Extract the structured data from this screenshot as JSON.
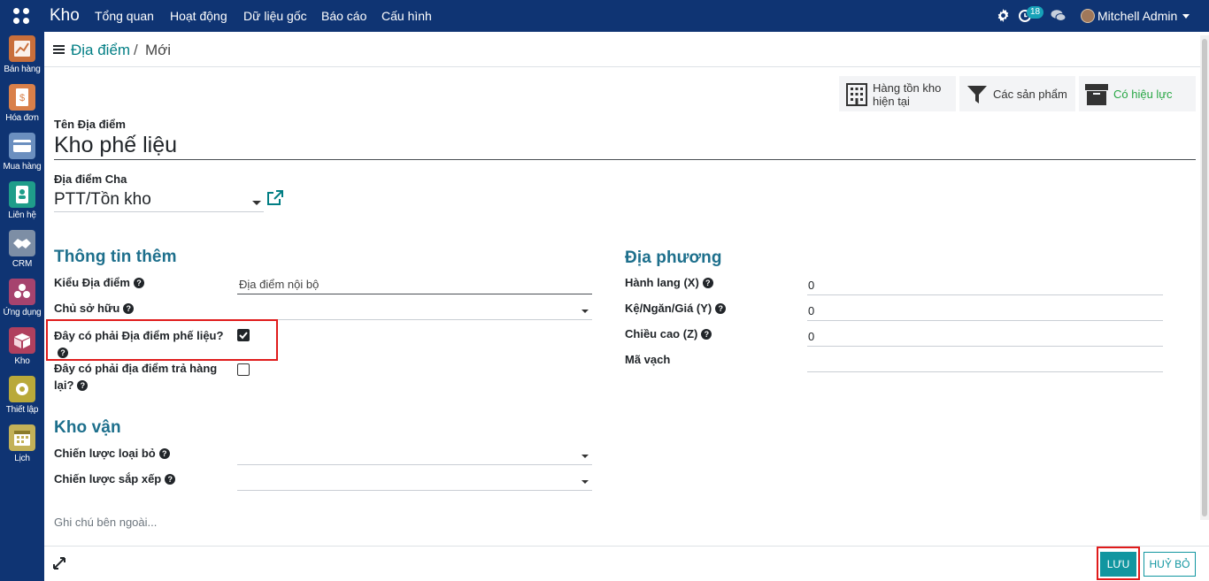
{
  "topbar": {
    "app_name": "Kho",
    "menus": [
      "Tổng quan",
      "Hoạt động",
      "Dữ liệu gốc",
      "Báo cáo",
      "Cấu hình"
    ],
    "activity_count": "18",
    "user_name": "Mitchell Admin",
    "icons": [
      "apps-grid-icon",
      "gear-icon",
      "clock-icon",
      "chat-icon",
      "user-avatar"
    ]
  },
  "sidebar": {
    "items": [
      {
        "label": "Bán hàng",
        "icon": "chart-icon",
        "color": "#c96f3b"
      },
      {
        "label": "Hóa đơn",
        "icon": "invoice-icon",
        "color": "#d9804a"
      },
      {
        "label": "Mua hàng",
        "icon": "card-icon",
        "color": "#6b8fbf"
      },
      {
        "label": "Liên hệ",
        "icon": "contact-icon",
        "color": "#1f9d8a"
      },
      {
        "label": "CRM",
        "icon": "handshake-icon",
        "color": "#7d8ea5"
      },
      {
        "label": "Ứng dụng",
        "icon": "cubes-icon",
        "color": "#a6436e"
      },
      {
        "label": "Kho",
        "icon": "box-icon",
        "color": "#b0405e"
      },
      {
        "label": "Thiết lập",
        "icon": "gear-icon",
        "color": "#b9a93a"
      },
      {
        "label": "Lịch",
        "icon": "calendar-icon",
        "color": "#c3b158"
      }
    ]
  },
  "breadcrumb": {
    "parent": "Địa điểm",
    "separator": "/",
    "current": "Mới"
  },
  "smart_buttons": {
    "stock": "Hàng tồn kho hiện tại",
    "products": "Các sản phẩm",
    "active": "Có hiệu lực"
  },
  "form": {
    "name_label": "Tên Địa điểm",
    "name_value": "Kho phế liệu",
    "parent_label": "Địa điểm Cha",
    "parent_value": "PTT/Tồn kho",
    "extra_section": "Thông tin thêm",
    "type_label": "Kiểu Địa điểm",
    "type_value": "Địa điểm nội bộ",
    "owner_label": "Chủ sở hữu",
    "scrap_label": "Đây có phải Địa điểm phế liệu?",
    "scrap_checked": true,
    "return_label": "Đây có phải địa điểm trả hàng lại?",
    "return_checked": false,
    "logistics_section": "Kho vận",
    "removal_label": "Chiến lược loại bỏ",
    "putaway_label": "Chiến lược sắp xếp",
    "local_section": "Địa phương",
    "x_label": "Hành lang (X)",
    "x_value": "0",
    "y_label": "Kệ/Ngăn/Giá (Y)",
    "y_value": "0",
    "z_label": "Chiều cao (Z)",
    "z_value": "0",
    "barcode_label": "Mã vạch",
    "note_placeholder": "Ghi chú bên ngoài..."
  },
  "footer": {
    "save": "LƯU",
    "discard": "HUỶ BỎ"
  },
  "colors": {
    "navbar": "#0f3473",
    "accent": "#017e84",
    "section": "#1d6f8c",
    "highlight": "#e01b1b"
  }
}
